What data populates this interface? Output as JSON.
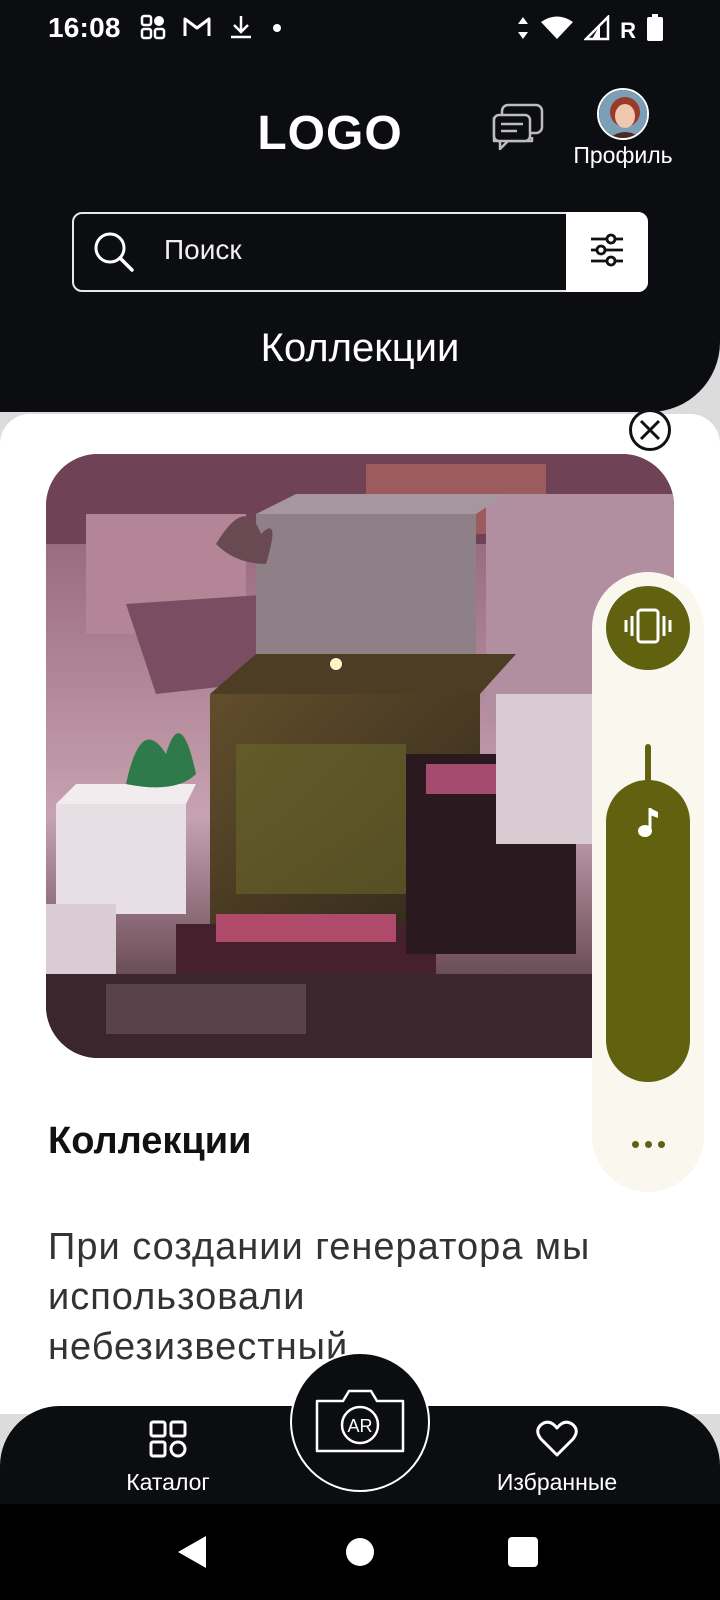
{
  "status_bar": {
    "time": "16:08",
    "carrier_letter": "R",
    "left_icons": [
      "apps-grid-icon",
      "gmail-icon",
      "download-icon",
      "dot-icon"
    ],
    "right_icons": [
      "data-arrows-icon",
      "wifi-icon",
      "signal-icon",
      "battery-icon"
    ]
  },
  "header": {
    "logo": "LOGO",
    "chat_icon": "chat-bubbles-icon",
    "profile_label": "Профиль",
    "search_placeholder": "Поиск",
    "section_title": "Коллекции"
  },
  "card": {
    "title": "Коллекции",
    "description": "При создании генератора мы использовали небезизвестный",
    "image_alt": "3D abstract scene with pink cubes"
  },
  "volume_panel": {
    "vibrate_icon": "vibrate-icon",
    "media_icon": "music-note-icon",
    "media_volume": 1.0,
    "more_icon": "more-dots-icon"
  },
  "bottom_nav": {
    "catalog_label": "Каталог",
    "favorites_label": "Избранные",
    "camera_icon": "camera-ar-icon"
  },
  "colors": {
    "header_bg": "#0c0d10",
    "accent_olive": "#61620f",
    "panel_bg": "#faf7ee"
  }
}
